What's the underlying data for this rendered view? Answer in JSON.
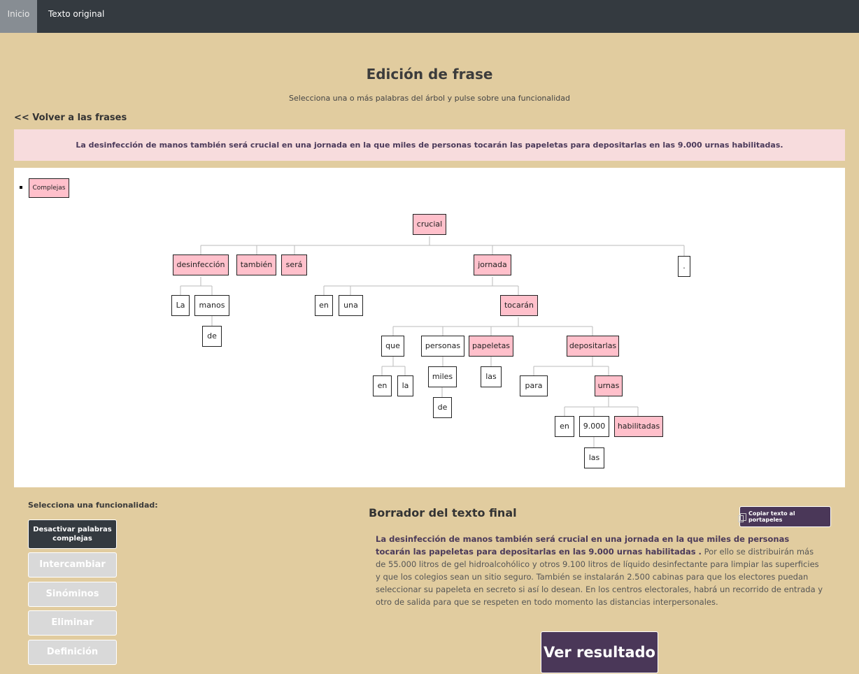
{
  "nav": {
    "home": "Inicio",
    "original": "Texto original"
  },
  "page": {
    "title": "Edición de frase",
    "subtitle": "Selecciona una o más palabras del árbol y pulse sobre una funcionalidad",
    "back": "<< Volver a las frases"
  },
  "sentence": "La desinfección de manos también será crucial en una jornada en la que miles de personas tocarán las papeletas para depositarlas en las 9.000 urnas habilitadas.",
  "legend": {
    "label": "Complejas"
  },
  "tree": {
    "nodes": [
      "crucial",
      "desinfección",
      "también",
      "será",
      "jornada",
      ".",
      "La",
      "manos",
      "de",
      "en",
      "una",
      "tocarán",
      "que",
      "personas",
      "papeletas",
      "depositarlas",
      "en",
      "la",
      "miles",
      "de",
      "las",
      "para",
      "urnas",
      "en",
      "9.000",
      "habilitadas",
      "las"
    ],
    "complex": [
      "crucial",
      "desinfección",
      "también",
      "será",
      "jornada",
      "tocarán",
      "papeletas",
      "depositarlas",
      "urnas",
      "habilitadas"
    ]
  },
  "functions": {
    "title": "Selecciona una funcionalidad:",
    "deactivate": "Desactivar palabras complejas",
    "swap": "Intercambiar",
    "synonyms": "Sinóminos",
    "delete": "Eliminar",
    "definition": "Definición"
  },
  "draft": {
    "title": "Borrador del texto final",
    "copy": "Copiar texto al portapeles",
    "bold": "La desinfección de manos también será crucial en una jornada en la que miles de personas tocarán las papeletas para depositarlas en las 9.000 urnas habilitadas .",
    "rest": " Por ello se distribuirán más de 55.000 litros de gel hidroalcohólico y otros 9.100 litros de líquido desinfectante para limpiar las superficies y que los colegios sean un sitio seguro. También se instalarán 2.500 cabinas para que los electores puedan seleccionar su papeleta en secreto si así lo desean. En los centros electorales, habrá un recorrido de entrada y otro de salida para que se respeten en todo momento las distancias interpersonales."
  },
  "result_button": "Ver resultado",
  "colors": {
    "background": "#e1cc9f",
    "navbar": "#343a40",
    "complex_word": "#ffc0cb",
    "accent": "#4a3758"
  }
}
